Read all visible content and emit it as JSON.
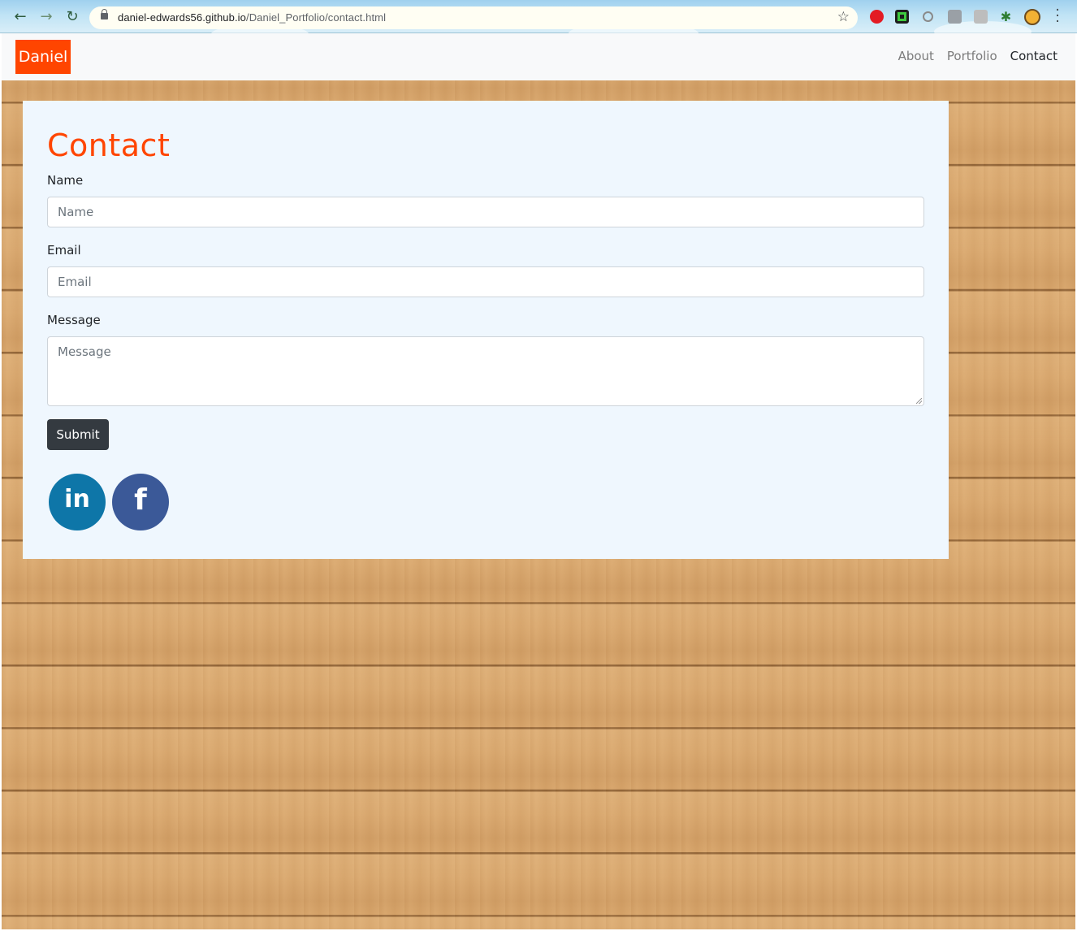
{
  "browser": {
    "url_host": "daniel-edwards56.github.io",
    "url_path": "/Daniel_Portfolio/contact.html"
  },
  "navbar": {
    "brand": "Daniel",
    "links": [
      {
        "label": "About"
      },
      {
        "label": "Portfolio"
      },
      {
        "label": "Contact",
        "active": true
      }
    ],
    "brand_color": "#ff4500"
  },
  "contact": {
    "title": "Contact",
    "fields": {
      "name": {
        "label": "Name",
        "placeholder": "Name"
      },
      "email": {
        "label": "Email",
        "placeholder": "Email"
      },
      "message": {
        "label": "Message",
        "placeholder": "Message"
      }
    },
    "submit_label": "Submit",
    "social": [
      {
        "name": "linkedin-icon",
        "glyph": "in",
        "color": "#0e76a8"
      },
      {
        "name": "facebook-icon",
        "glyph": "f",
        "color": "#3b5998"
      }
    ]
  }
}
